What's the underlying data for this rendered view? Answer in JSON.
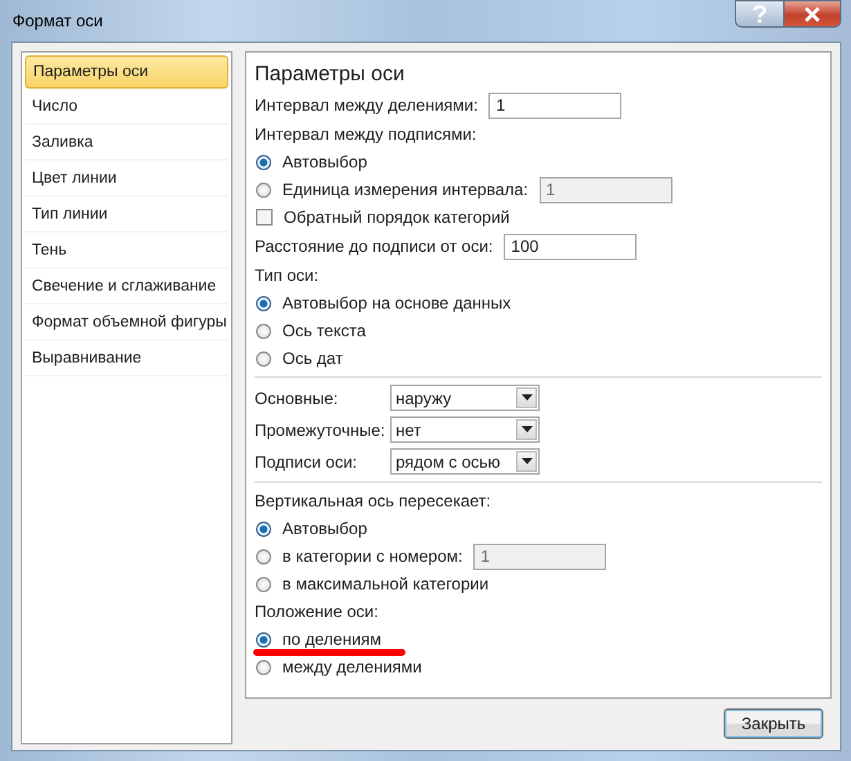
{
  "window": {
    "title": "Формат оси"
  },
  "sidebar": {
    "items": [
      {
        "label": "Параметры оси",
        "selected": true
      },
      {
        "label": "Число",
        "selected": false
      },
      {
        "label": "Заливка",
        "selected": false
      },
      {
        "label": "Цвет линии",
        "selected": false
      },
      {
        "label": "Тип линии",
        "selected": false
      },
      {
        "label": "Тень",
        "selected": false
      },
      {
        "label": "Свечение и сглаживание",
        "selected": false
      },
      {
        "label": "Формат объемной фигуры",
        "selected": false
      },
      {
        "label": "Выравнивание",
        "selected": false
      }
    ]
  },
  "panel": {
    "title": "Параметры оси",
    "sections": [
      {
        "rows": [
          {
            "kind": "field",
            "label": "Интервал между делениями:",
            "value": "1",
            "disabled": false
          },
          {
            "kind": "heading",
            "label": "Интервал между подписями:"
          },
          {
            "kind": "radio",
            "label": "Автовыбор",
            "selected": true
          },
          {
            "kind": "radio",
            "label": "Единица измерения интервала:",
            "selected": false,
            "field": {
              "value": "1",
              "disabled": true
            }
          },
          {
            "kind": "checkbox",
            "label": "Обратный порядок категорий",
            "checked": false
          },
          {
            "kind": "field",
            "label": "Расстояние до подписи от оси:",
            "value": "100",
            "disabled": false
          },
          {
            "kind": "heading",
            "label": "Тип оси:"
          },
          {
            "kind": "radio",
            "label": "Автовыбор на основе данных",
            "selected": true
          },
          {
            "kind": "radio",
            "label": "Ось текста",
            "selected": false
          },
          {
            "kind": "radio",
            "label": "Ось дат",
            "selected": false
          }
        ]
      },
      {
        "rows": [
          {
            "kind": "dropdown",
            "label": "Основные:",
            "value": "наружу"
          },
          {
            "kind": "dropdown",
            "label": "Промежуточные:",
            "value": "нет"
          },
          {
            "kind": "dropdown",
            "label": "Подписи оси:",
            "value": "рядом с осью"
          }
        ]
      },
      {
        "rows": [
          {
            "kind": "heading",
            "label": "Вертикальная ось пересекает:"
          },
          {
            "kind": "radio",
            "label": "Автовыбор",
            "selected": true
          },
          {
            "kind": "radio",
            "label": "в категории с номером:",
            "selected": false,
            "field": {
              "value": "1",
              "disabled": true
            }
          },
          {
            "kind": "radio",
            "label": "в максимальной категории",
            "selected": false
          },
          {
            "kind": "heading",
            "label": "Положение оси:"
          },
          {
            "kind": "radio",
            "label": "по делениям",
            "selected": true,
            "marked": true
          },
          {
            "kind": "radio",
            "label": "между делениями",
            "selected": false
          }
        ]
      }
    ]
  },
  "buttons": [
    "Закрыть"
  ]
}
